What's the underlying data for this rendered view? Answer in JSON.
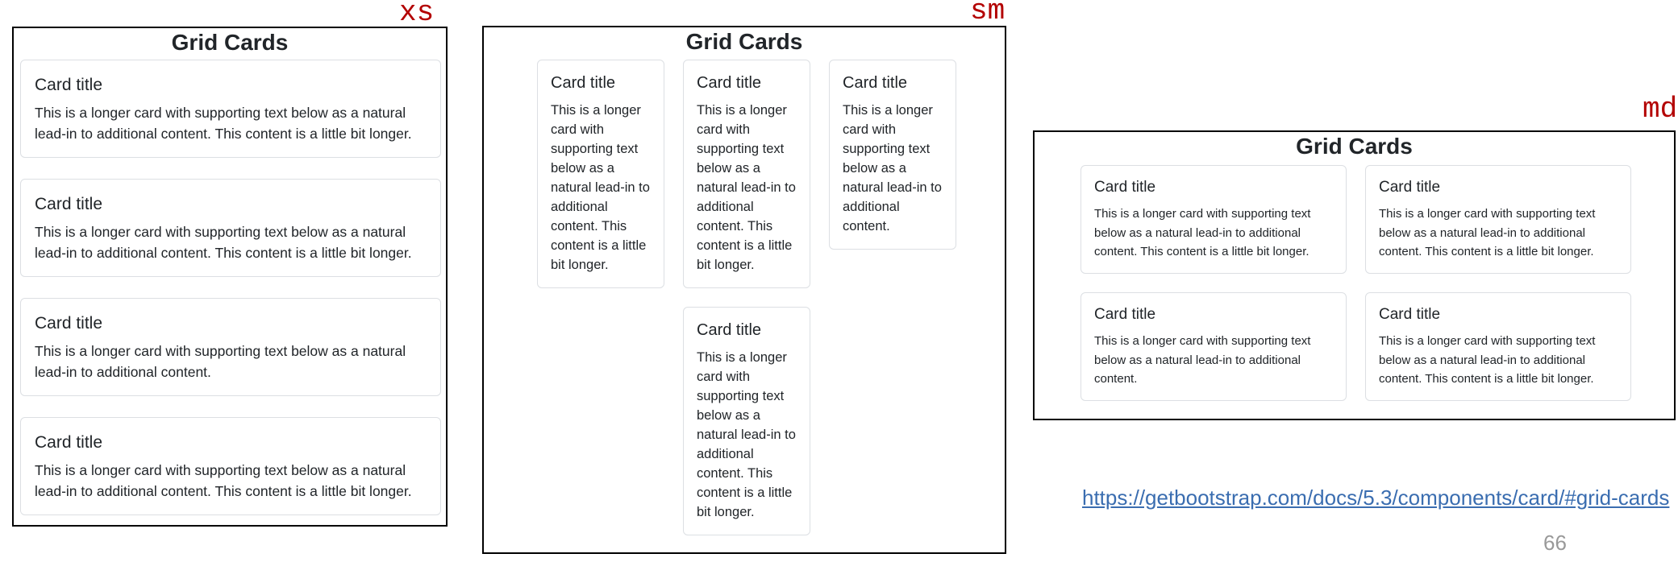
{
  "labels": {
    "xs": "xs",
    "sm": "sm",
    "md": "md"
  },
  "frame_title": "Grid Cards",
  "xs_cards": [
    {
      "title": "Card title",
      "text": "This is a longer card with supporting text below as a natural lead-in to additional content. This content is a little bit longer."
    },
    {
      "title": "Card title",
      "text": "This is a longer card with supporting text below as a natural lead-in to additional content. This content is a little bit longer."
    },
    {
      "title": "Card title",
      "text": "This is a longer card with supporting text below as a natural lead-in to additional content."
    },
    {
      "title": "Card title",
      "text": "This is a longer card with supporting text below as a natural lead-in to additional content. This content is a little bit longer."
    }
  ],
  "sm_cards": [
    {
      "title": "Card title",
      "text": "This is a longer card with supporting text below as a natural lead-in to additional content. This content is a little bit longer."
    },
    {
      "title": "Card title",
      "text": "This is a longer card with supporting text below as a natural lead-in to additional content. This content is a little bit longer."
    },
    {
      "title": "Card title",
      "text": "This is a longer card with supporting text below as a natural lead-in to additional content."
    },
    {
      "title": "Card title",
      "text": "This is a longer card with supporting text below as a natural lead-in to additional content. This content is a little bit longer."
    }
  ],
  "md_cards": [
    {
      "title": "Card title",
      "text": "This is a longer card with supporting text below as a natural lead-in to additional content. This content is a little bit longer."
    },
    {
      "title": "Card title",
      "text": "This is a longer card with supporting text below as a natural lead-in to additional content. This content is a little bit longer."
    },
    {
      "title": "Card title",
      "text": "This is a longer card with supporting text below as a natural lead-in to additional content."
    },
    {
      "title": "Card title",
      "text": "This is a longer card with supporting text below as a natural lead-in to additional content. This content is a little bit longer."
    }
  ],
  "link": "https://getbootstrap.com/docs/5.3/components/card/#grid-cards",
  "page_number": "66"
}
